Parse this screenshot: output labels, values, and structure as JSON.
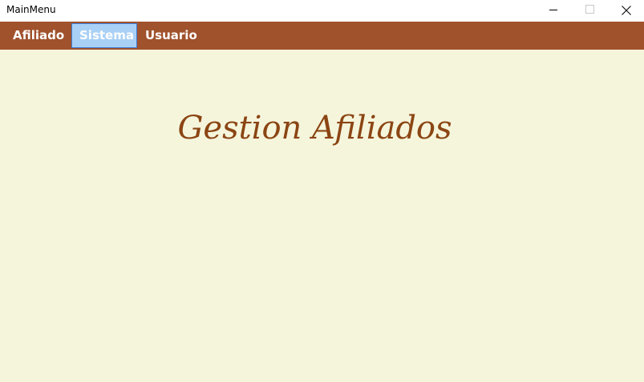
{
  "window": {
    "title": "MainMenu",
    "controls": {
      "minimize": "minimize-icon",
      "maximize": "maximize-icon",
      "close": "close-icon"
    }
  },
  "menu": {
    "items": [
      {
        "label": "Afiliado",
        "state": "normal"
      },
      {
        "label": "Sistema",
        "state": "highlighted"
      },
      {
        "label": "Usuario",
        "state": "normal"
      }
    ]
  },
  "main": {
    "heading": "Gestion Afiliados"
  },
  "colors": {
    "menu_bar": "#a0522d",
    "menu_highlight": "#a9d0f5",
    "menu_highlight_border": "#3d7fd6",
    "background": "#f5f5dc",
    "heading": "#8b4513"
  }
}
